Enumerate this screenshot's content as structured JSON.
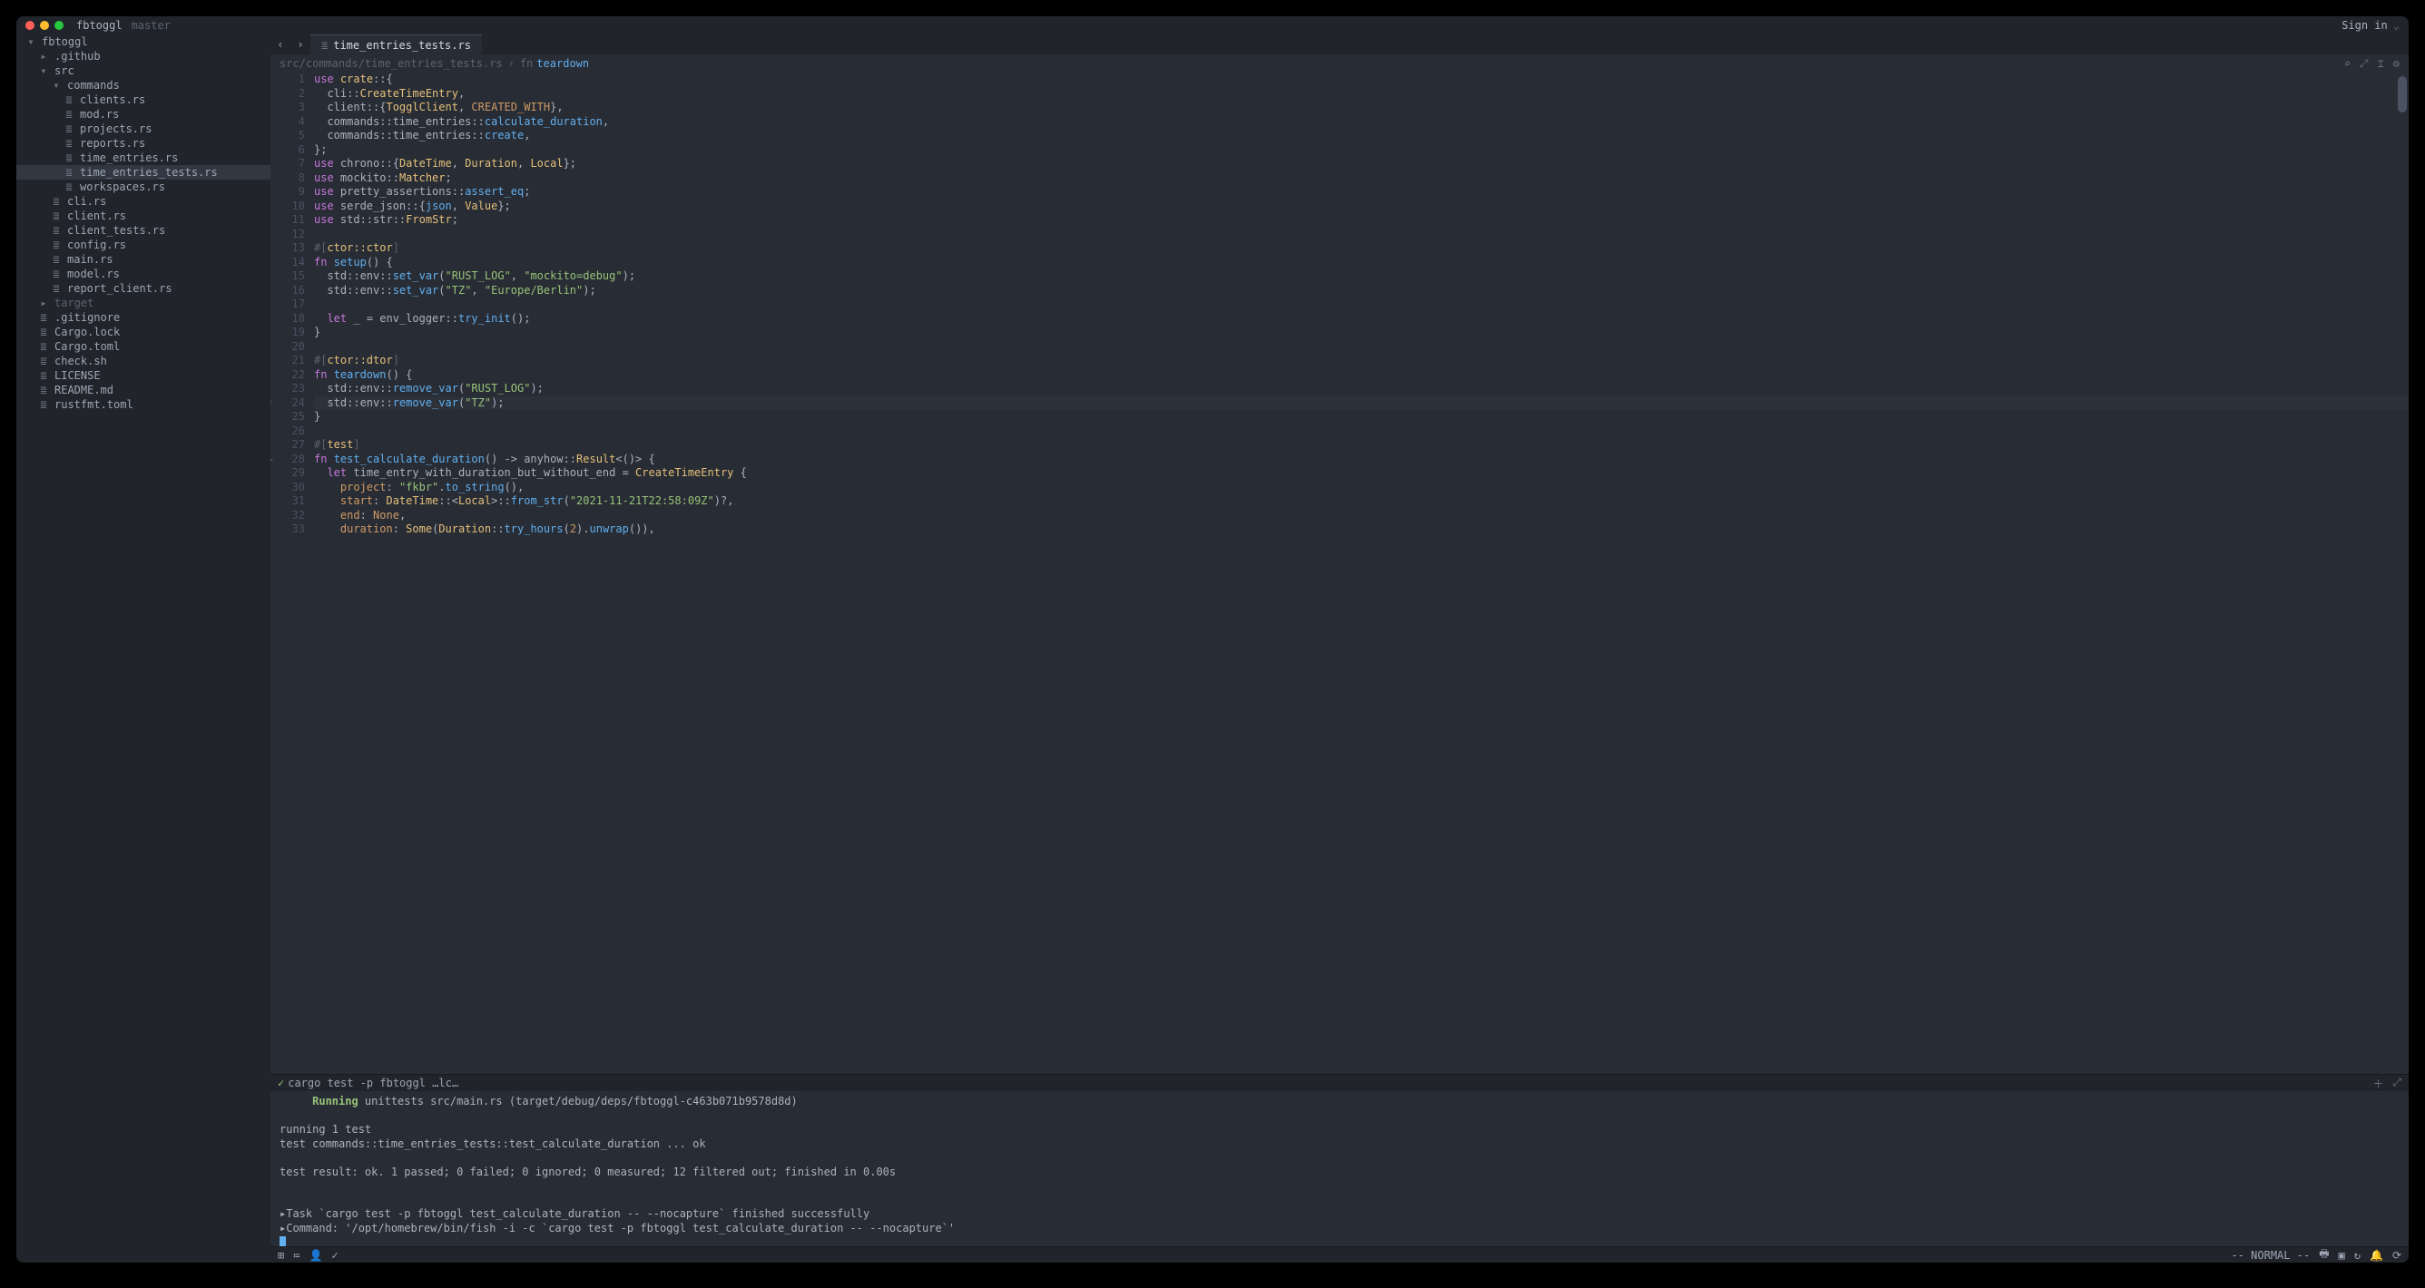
{
  "titlebar": {
    "project": "fbtoggl",
    "branch": "master",
    "signin": "Sign in"
  },
  "tabs": {
    "active": "time_entries_tests.rs"
  },
  "breadcrumb": {
    "path": "src/commands/time_entries_tests.rs",
    "seg2": "fn",
    "seg3": "teardown"
  },
  "tree": [
    {
      "d": 0,
      "i": "folder-open",
      "n": "fbtoggl"
    },
    {
      "d": 1,
      "i": "folder",
      "n": ".github"
    },
    {
      "d": 1,
      "i": "folder-open",
      "n": "src"
    },
    {
      "d": 2,
      "i": "folder-open",
      "n": "commands"
    },
    {
      "d": 3,
      "i": "file",
      "n": "clients.rs"
    },
    {
      "d": 3,
      "i": "file",
      "n": "mod.rs"
    },
    {
      "d": 3,
      "i": "file",
      "n": "projects.rs"
    },
    {
      "d": 3,
      "i": "file",
      "n": "reports.rs"
    },
    {
      "d": 3,
      "i": "file",
      "n": "time_entries.rs"
    },
    {
      "d": 3,
      "i": "file",
      "n": "time_entries_tests.rs",
      "active": true
    },
    {
      "d": 3,
      "i": "file",
      "n": "workspaces.rs"
    },
    {
      "d": 2,
      "i": "file",
      "n": "cli.rs"
    },
    {
      "d": 2,
      "i": "file",
      "n": "client.rs"
    },
    {
      "d": 2,
      "i": "file",
      "n": "client_tests.rs"
    },
    {
      "d": 2,
      "i": "file",
      "n": "config.rs"
    },
    {
      "d": 2,
      "i": "file",
      "n": "main.rs"
    },
    {
      "d": 2,
      "i": "file",
      "n": "model.rs"
    },
    {
      "d": 2,
      "i": "file",
      "n": "report_client.rs"
    },
    {
      "d": 1,
      "i": "folder",
      "n": "target",
      "dim": true
    },
    {
      "d": 1,
      "i": "file",
      "n": ".gitignore"
    },
    {
      "d": 1,
      "i": "file",
      "n": "Cargo.lock"
    },
    {
      "d": 1,
      "i": "file",
      "n": "Cargo.toml"
    },
    {
      "d": 1,
      "i": "file",
      "n": "check.sh"
    },
    {
      "d": 1,
      "i": "file",
      "n": "LICENSE"
    },
    {
      "d": 1,
      "i": "file",
      "n": "README.md"
    },
    {
      "d": 1,
      "i": "file",
      "n": "rustfmt.toml"
    }
  ],
  "lines": [
    {
      "n": 1,
      "h": "<span class='kw'>use</span> <span class='ty'>crate</span>::{"
    },
    {
      "n": 2,
      "h": "  cli::<span class='ty'>CreateTimeEntry</span>,"
    },
    {
      "n": 3,
      "h": "  client::{<span class='ty'>TogglClient</span>, <span class='cnst'>CREATED_WITH</span>},"
    },
    {
      "n": 4,
      "h": "  commands::time_entries::<span class='fn'>calculate_duration</span>,"
    },
    {
      "n": 5,
      "h": "  commands::time_entries::<span class='fn'>create</span>,"
    },
    {
      "n": 6,
      "h": "};"
    },
    {
      "n": 7,
      "h": "<span class='kw'>use</span> chrono::{<span class='ty'>DateTime</span>, <span class='ty'>Duration</span>, <span class='ty'>Local</span>};"
    },
    {
      "n": 8,
      "h": "<span class='kw'>use</span> mockito::<span class='ty'>Matcher</span>;"
    },
    {
      "n": 9,
      "h": "<span class='kw'>use</span> pretty_assertions::<span class='fn'>assert_eq</span>;"
    },
    {
      "n": 10,
      "h": "<span class='kw'>use</span> serde_json::{<span class='fn'>json</span>, <span class='ty'>Value</span>};"
    },
    {
      "n": 11,
      "h": "<span class='kw'>use</span> std::str::<span class='ty'>FromStr</span>;"
    },
    {
      "n": 12,
      "h": ""
    },
    {
      "n": 13,
      "h": "<span class='cm'>#[</span><span class='ty'>ctor::ctor</span><span class='cm'>]</span>"
    },
    {
      "n": 14,
      "h": "<span class='kw'>fn</span> <span class='fn'>setup</span>() {"
    },
    {
      "n": 15,
      "h": "  std::env::<span class='fn'>set_var</span>(<span class='str'>\"RUST_LOG\"</span>, <span class='str'>\"mockito=debug\"</span>);"
    },
    {
      "n": 16,
      "h": "  std::env::<span class='fn'>set_var</span>(<span class='str'>\"TZ\"</span>, <span class='str'>\"Europe/Berlin\"</span>);"
    },
    {
      "n": 17,
      "h": ""
    },
    {
      "n": 18,
      "h": "  <span class='kw'>let</span> _ = env_logger::<span class='fn'>try_init</span>();"
    },
    {
      "n": 19,
      "h": "}"
    },
    {
      "n": 20,
      "h": ""
    },
    {
      "n": 21,
      "h": "<span class='cm'>#[</span><span class='ty'>ctor::dtor</span><span class='cm'>]</span>"
    },
    {
      "n": 22,
      "h": "<span class='kw'>fn</span> <span class='fn'>teardown</span>() {"
    },
    {
      "n": 23,
      "h": "  std::env::<span class='fn'>remove_var</span>(<span class='str'>\"RUST_LOG\"</span>);"
    },
    {
      "n": 24,
      "h": "  std::env::<span class='fn'>remove_var</span>(<span class='str'>\"TZ\"</span>);",
      "hl": true,
      "mark": "⚡"
    },
    {
      "n": 25,
      "h": "}"
    },
    {
      "n": 26,
      "h": ""
    },
    {
      "n": 27,
      "h": "<span class='cm'>#[</span><span class='ty'>test</span><span class='cm'>]</span>"
    },
    {
      "n": 28,
      "h": "<span class='kw'>fn</span> <span class='fn'>test_calculate_duration</span>() -> anyhow::<span class='ty'>Result</span>&lt;()&gt; {",
      "mark": "▷"
    },
    {
      "n": 29,
      "h": "  <span class='kw'>let</span> time_entry_with_duration_but_without_end = <span class='ty'>CreateTimeEntry</span> {"
    },
    {
      "n": 30,
      "h": "    <span class='cnst'>project</span>: <span class='str'>\"fkbr\"</span>.<span class='fn'>to_string</span>(),"
    },
    {
      "n": 31,
      "h": "    <span class='cnst'>start</span>: <span class='ty'>DateTime</span>::&lt;<span class='ty'>Local</span>&gt;::<span class='fn'>from_str</span>(<span class='str'>\"2021-11-21T22:58:09Z\"</span>)?,"
    },
    {
      "n": 32,
      "h": "    <span class='cnst'>end</span>: <span class='cnst'>None</span>,"
    },
    {
      "n": 33,
      "h": "    <span class='cnst'>duration</span>: <span class='ty'>Some</span>(<span class='ty'>Duration</span>::<span class='fn'>try_hours</span>(<span class='num'>2</span>).<span class='fn'>unwrap</span>()),"
    }
  ],
  "panel": {
    "tab_label": "cargo test -p fbtoggl …lc…",
    "lines": [
      "     <span class='term-run'>Running</span> unittests src/main.rs (target/debug/deps/fbtoggl-c463b071b9578d8d)",
      "",
      "running 1 test",
      "test commands::time_entries_tests::test_calculate_duration ... ok",
      "",
      "test result: ok. 1 passed; 0 failed; 0 ignored; 0 measured; 12 filtered out; finished in 0.00s",
      "",
      "",
      "<span class='term-dim'>▸Task `cargo test -p fbtoggl test_calculate_duration -- --nocapture` finished successfully</span>",
      "<span class='term-dim'>▸Command: '/opt/homebrew/bin/fish -i -c `cargo test -p fbtoggl test_calculate_duration -- --nocapture`'</span>"
    ]
  },
  "status": {
    "mode": "-- NORMAL --"
  },
  "icons": {
    "folder": "▸ 📁",
    "folder-open": "▾ 📂",
    "file": "≣",
    "search": "⌕",
    "fullscreen": "⤢",
    "settings": "⚙",
    "pin": "⇱",
    "plus": "＋",
    "nav_back": "‹",
    "nav_fwd": "›",
    "chev_down": "⌄",
    "terminal": "⌘",
    "check": "✓",
    "cursor": "⌶"
  }
}
